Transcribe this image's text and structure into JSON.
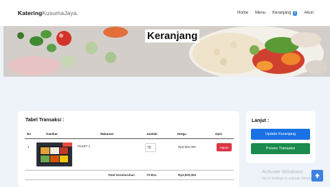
{
  "brand": {
    "bold": "Katering",
    "light": "KusumaJaya."
  },
  "nav": {
    "home": "Home",
    "menu": "Menu",
    "cart": "Keranjang",
    "cart_count": "0",
    "account": "Akun"
  },
  "hero": {
    "title": "Keranjang"
  },
  "transaction": {
    "title": "Tabel Transaksi :",
    "headers": {
      "no": "No",
      "image": "Gambar",
      "food": "Makanan",
      "qty": "Jumlah",
      "price": "Harga",
      "option": "Opsi"
    },
    "rows": [
      {
        "no": "1",
        "food": "PAKET 1",
        "qty": "70",
        "price": "Rp3,500,000",
        "action": "Hapus"
      }
    ],
    "total": {
      "label": "Total Keseluruhan",
      "qty": "70 Box",
      "price": "Rp3,500,000"
    }
  },
  "side": {
    "title": "Lanjut :",
    "update_button": "Update Keranjang",
    "process_button": "Proses Transaksi"
  },
  "watermark": {
    "line1": "Activate Windows",
    "line2": "Go to Settings to activate Windows."
  },
  "colors": {
    "accent_blue": "#1971e3",
    "green": "#1a8b4c",
    "danger": "#dc3545",
    "background": "#eef3fa"
  },
  "icons": {
    "scroll_top": "arrow-up-icon"
  }
}
